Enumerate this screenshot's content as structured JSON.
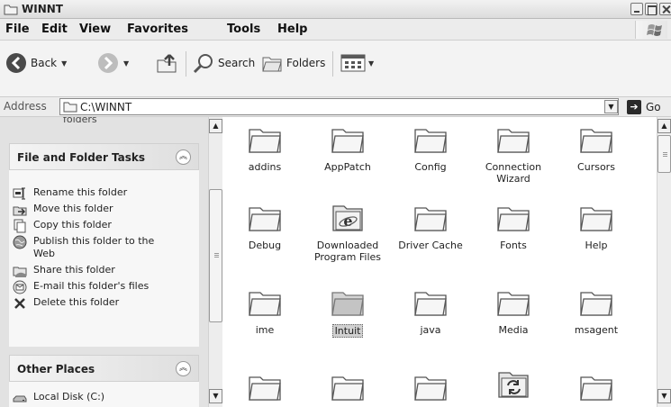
{
  "window": {
    "title": "WINNT"
  },
  "menu": [
    "File",
    "Edit",
    "View",
    "Favorites",
    "Tools",
    "Help"
  ],
  "toolbar": {
    "back_label": "Back",
    "search_label": "Search",
    "folders_label": "Folders"
  },
  "address": {
    "label": "Address",
    "value": "C:\\WINNT",
    "go_label": "Go"
  },
  "taskpane": {
    "cut_text": "folders",
    "file_tasks": {
      "title": "File and Folder Tasks",
      "items": [
        {
          "label": "Rename this folder",
          "icon": "rename-icon"
        },
        {
          "label": "Move this folder",
          "icon": "move-icon"
        },
        {
          "label": "Copy this folder",
          "icon": "copy-icon"
        },
        {
          "label": "Publish this folder to the Web",
          "icon": "publish-web-icon"
        },
        {
          "label": "Share this folder",
          "icon": "share-icon"
        },
        {
          "label": "E-mail this folder's files",
          "icon": "email-icon"
        },
        {
          "label": "Delete this folder",
          "icon": "delete-icon"
        }
      ]
    },
    "other_places": {
      "title": "Other Places",
      "items": [
        {
          "label": "Local Disk (C:)",
          "icon": "local-disk-icon"
        }
      ]
    }
  },
  "files": [
    {
      "name": "addins",
      "icon": "folder-icon"
    },
    {
      "name": "AppPatch",
      "icon": "folder-icon"
    },
    {
      "name": "Config",
      "icon": "folder-icon"
    },
    {
      "name": "Connection Wizard",
      "icon": "folder-icon"
    },
    {
      "name": "Cursors",
      "icon": "folder-icon"
    },
    {
      "name": "Debug",
      "icon": "folder-icon"
    },
    {
      "name": "Downloaded Program Files",
      "icon": "ie-folder-icon"
    },
    {
      "name": "Driver Cache",
      "icon": "folder-icon"
    },
    {
      "name": "Fonts",
      "icon": "folder-icon"
    },
    {
      "name": "Help",
      "icon": "folder-icon"
    },
    {
      "name": "ime",
      "icon": "folder-icon"
    },
    {
      "name": "Intuit",
      "icon": "folder-icon",
      "selected": true
    },
    {
      "name": "java",
      "icon": "folder-icon"
    },
    {
      "name": "Media",
      "icon": "folder-icon"
    },
    {
      "name": "msagent",
      "icon": "folder-icon"
    },
    {
      "name": "",
      "icon": "folder-icon"
    },
    {
      "name": "",
      "icon": "folder-icon"
    },
    {
      "name": "",
      "icon": "folder-icon"
    },
    {
      "name": "",
      "icon": "sync-folder-icon"
    },
    {
      "name": "",
      "icon": "folder-icon"
    }
  ]
}
